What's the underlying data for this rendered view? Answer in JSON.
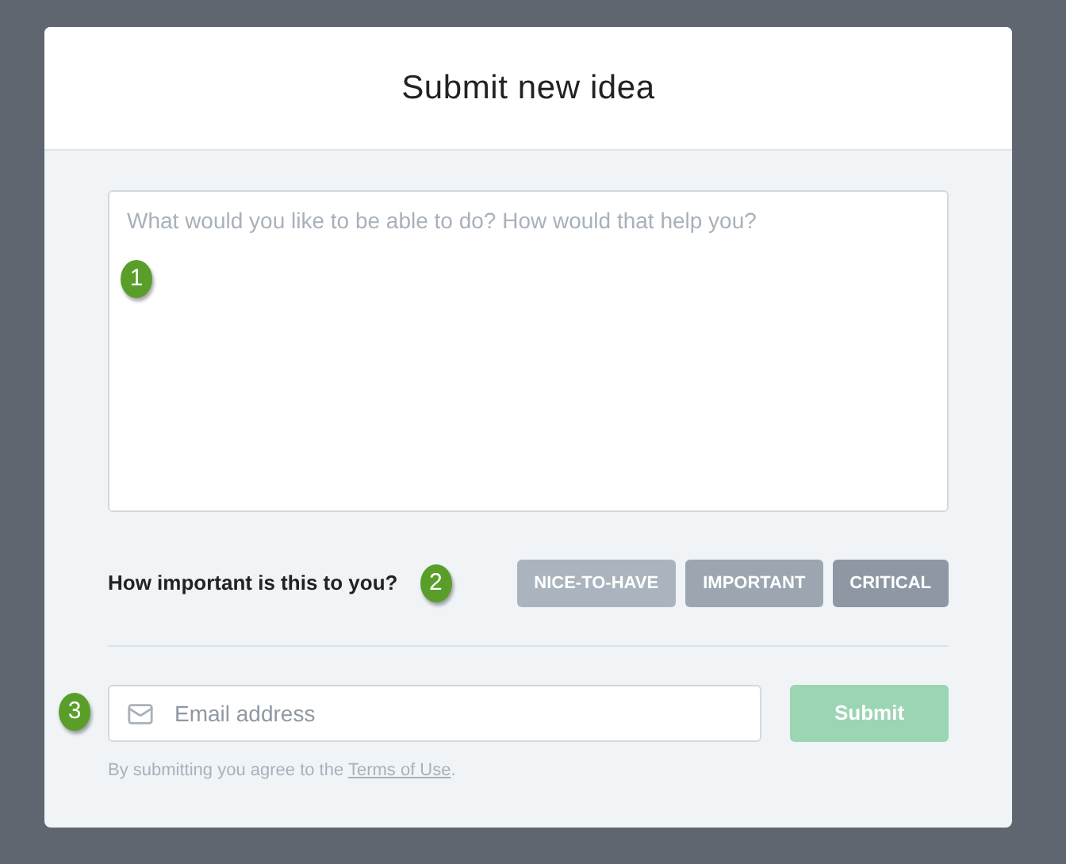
{
  "dialog": {
    "title": "Submit new idea",
    "idea_field": {
      "placeholder": "What would you like to be able to do? How would that help you?",
      "marker": "1"
    },
    "importance": {
      "question": "How important is this to you?",
      "marker": "2",
      "options": [
        {
          "label": "NICE-TO-HAVE",
          "color": "#aab4be"
        },
        {
          "label": "IMPORTANT",
          "color": "#9ba6b1"
        },
        {
          "label": "CRITICAL",
          "color": "#8d98a4"
        }
      ]
    },
    "email_field": {
      "placeholder": "Email address",
      "marker": "3"
    },
    "submit": {
      "label": "Submit",
      "disabled": true
    },
    "terms": {
      "text": "By submitting you agree to the",
      "link": "Terms of Use",
      "end": "."
    }
  }
}
